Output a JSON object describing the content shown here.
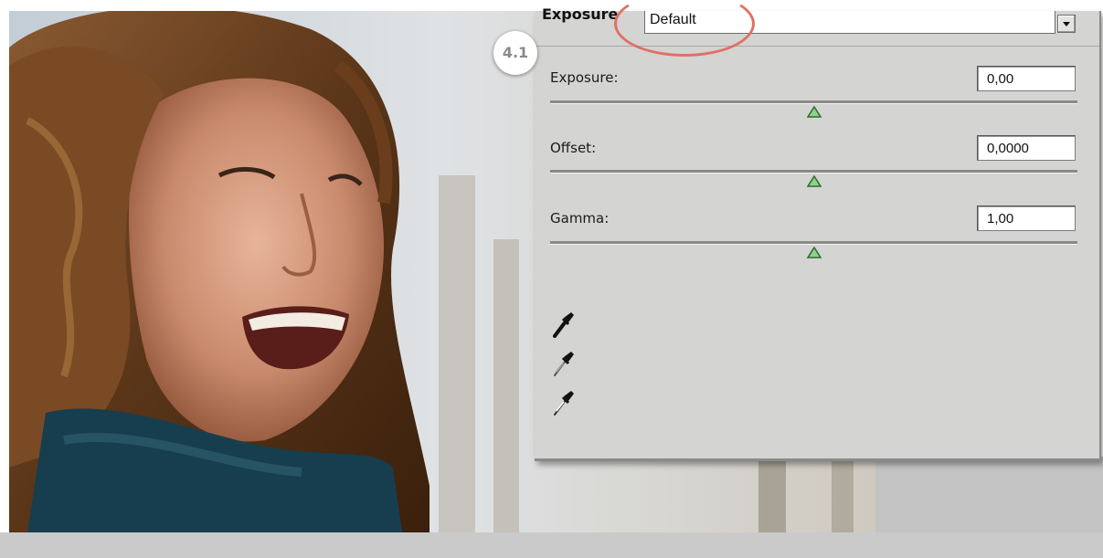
{
  "panel": {
    "preset_label": "Exposure",
    "preset_value": "Default",
    "step_badge": "4.1"
  },
  "params": [
    {
      "label": "Exposure:",
      "value": "0,00",
      "slider_position": 0.5
    },
    {
      "label": "Offset:",
      "value": "0,0000",
      "slider_position": 0.5
    },
    {
      "label": "Gamma:",
      "value": "1,00",
      "slider_position": 0.5
    }
  ],
  "tools": {
    "icons": [
      "black-point-eyedropper-icon",
      "gray-point-eyedropper-icon",
      "white-point-eyedropper-icon"
    ]
  },
  "colors": {
    "panel_bg": "#d4d4d2",
    "highlight": "#e07066",
    "slider_thumb": "#4a9a4a"
  }
}
